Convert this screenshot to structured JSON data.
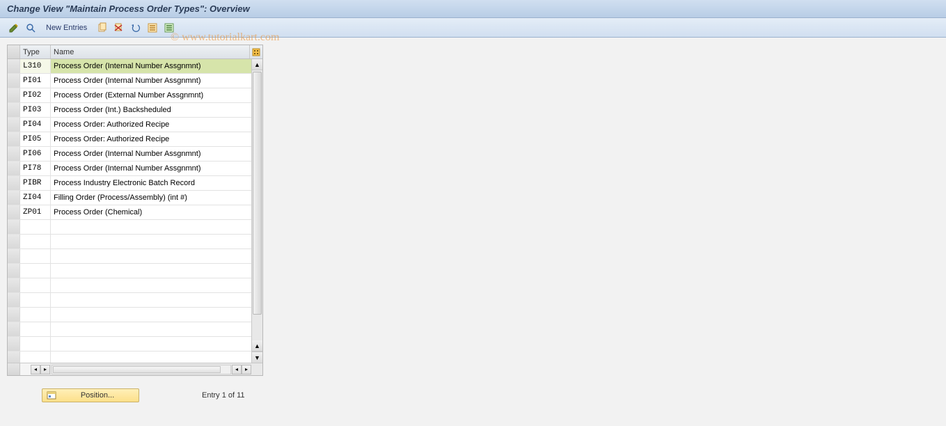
{
  "title": "Change View \"Maintain Process Order Types\": Overview",
  "toolbar": {
    "new_entries_label": "New Entries"
  },
  "watermark": "© www.tutorialkart.com",
  "table": {
    "headers": {
      "type": "Type",
      "name": "Name"
    },
    "rows": [
      {
        "type": "L310",
        "name": "Process Order (Internal Number Assgnmnt)",
        "selected": true
      },
      {
        "type": "PI01",
        "name": "Process Order (Internal Number Assgnmnt)"
      },
      {
        "type": "PI02",
        "name": "Process Order (External Number Assgnmnt)"
      },
      {
        "type": "PI03",
        "name": "Process Order (Int.) Backsheduled"
      },
      {
        "type": "PI04",
        "name": "Process Order: Authorized Recipe"
      },
      {
        "type": "PI05",
        "name": "Process Order: Authorized Recipe"
      },
      {
        "type": "PI06",
        "name": "Process Order (Internal Number Assgnmnt)"
      },
      {
        "type": "PI78",
        "name": "Process Order (Internal Number Assgnmnt)"
      },
      {
        "type": "PIBR",
        "name": "Process Industry Electronic Batch Record"
      },
      {
        "type": "ZI04",
        "name": "Filling Order (Process/Assembly) (int #)"
      },
      {
        "type": "ZP01",
        "name": "Process Order (Chemical)"
      },
      {
        "type": "",
        "name": ""
      },
      {
        "type": "",
        "name": ""
      },
      {
        "type": "",
        "name": ""
      },
      {
        "type": "",
        "name": ""
      },
      {
        "type": "",
        "name": ""
      },
      {
        "type": "",
        "name": ""
      },
      {
        "type": "",
        "name": ""
      },
      {
        "type": "",
        "name": ""
      },
      {
        "type": "",
        "name": ""
      },
      {
        "type": "",
        "name": ""
      }
    ]
  },
  "footer": {
    "position_label": "Position...",
    "entry_info": "Entry 1 of 11"
  }
}
